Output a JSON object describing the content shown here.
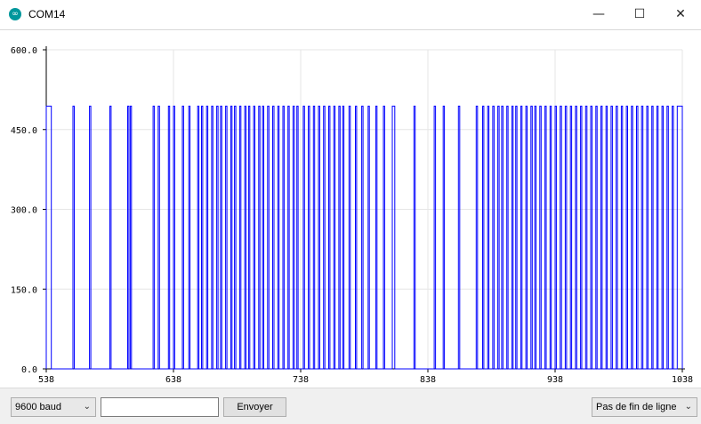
{
  "window": {
    "title": "COM14",
    "icon": "arduino-logo-icon",
    "controls": {
      "minimize": "—",
      "maximize": "☐",
      "close": "✕"
    }
  },
  "colors": {
    "series": "#0000ff",
    "grid": "#e6e6e6",
    "axis": "#000000",
    "panel": "#f0f0f0",
    "icon": "#00979c"
  },
  "chart_data": {
    "type": "line",
    "xlim": [
      538,
      1038
    ],
    "ylim": [
      0,
      600
    ],
    "xticks": [
      "538",
      "638",
      "738",
      "838",
      "938",
      "1038"
    ],
    "yticks": [
      "0.0",
      "150.0",
      "300.0",
      "450.0",
      "600.0"
    ],
    "grid": true,
    "high_value": 494,
    "low_value": 0,
    "pulses": [
      [
        538,
        542
      ],
      [
        559,
        560
      ],
      [
        572,
        573
      ],
      [
        588,
        589
      ],
      [
        602,
        603
      ],
      [
        604,
        605
      ],
      [
        622,
        623
      ],
      [
        626,
        627
      ],
      [
        634,
        635
      ],
      [
        638,
        639
      ],
      [
        645,
        646
      ],
      [
        650,
        651
      ],
      [
        657,
        658
      ],
      [
        660,
        661
      ],
      [
        664,
        665
      ],
      [
        668,
        669
      ],
      [
        672,
        673
      ],
      [
        675,
        676
      ],
      [
        679,
        680
      ],
      [
        683,
        684
      ],
      [
        686,
        687
      ],
      [
        690,
        691
      ],
      [
        694,
        695
      ],
      [
        697,
        698
      ],
      [
        701,
        702
      ],
      [
        705,
        706
      ],
      [
        708,
        709
      ],
      [
        712,
        713
      ],
      [
        716,
        717
      ],
      [
        720,
        721
      ],
      [
        724,
        725
      ],
      [
        728,
        729
      ],
      [
        732,
        733
      ],
      [
        735,
        736
      ],
      [
        740,
        741
      ],
      [
        744,
        745
      ],
      [
        748,
        749
      ],
      [
        752,
        753
      ],
      [
        756,
        757
      ],
      [
        760,
        761
      ],
      [
        764,
        765
      ],
      [
        768,
        769
      ],
      [
        771,
        772
      ],
      [
        776,
        777
      ],
      [
        781,
        782
      ],
      [
        786,
        787
      ],
      [
        791,
        792
      ],
      [
        797,
        798
      ],
      [
        803,
        804
      ],
      [
        810,
        812
      ],
      [
        827,
        828
      ],
      [
        843,
        844
      ],
      [
        850,
        851
      ],
      [
        862,
        863
      ],
      [
        876,
        877
      ],
      [
        881,
        882
      ],
      [
        885,
        886
      ],
      [
        889,
        890
      ],
      [
        893,
        894
      ],
      [
        896,
        897
      ],
      [
        900,
        901
      ],
      [
        904,
        905
      ],
      [
        907,
        908
      ],
      [
        911,
        912
      ],
      [
        915,
        916
      ],
      [
        919,
        920
      ],
      [
        922,
        923
      ],
      [
        926,
        927
      ],
      [
        930,
        931
      ],
      [
        934,
        935
      ],
      [
        938,
        939
      ],
      [
        942,
        943
      ],
      [
        946,
        947
      ],
      [
        950,
        951
      ],
      [
        954,
        955
      ],
      [
        958,
        959
      ],
      [
        962,
        963
      ],
      [
        966,
        967
      ],
      [
        970,
        971
      ],
      [
        974,
        975
      ],
      [
        978,
        979
      ],
      [
        982,
        983
      ],
      [
        986,
        987
      ],
      [
        990,
        991
      ],
      [
        994,
        995
      ],
      [
        998,
        999
      ],
      [
        1002,
        1003
      ],
      [
        1006,
        1007
      ],
      [
        1010,
        1011
      ],
      [
        1014,
        1015
      ],
      [
        1018,
        1019
      ],
      [
        1022,
        1023
      ],
      [
        1026,
        1027
      ],
      [
        1030,
        1031
      ],
      [
        1034,
        1038
      ]
    ]
  },
  "footer": {
    "baud_select": "9600 baud",
    "send_input_value": "",
    "send_button": "Envoyer",
    "line_ending_select": "Pas de fin de ligne"
  }
}
